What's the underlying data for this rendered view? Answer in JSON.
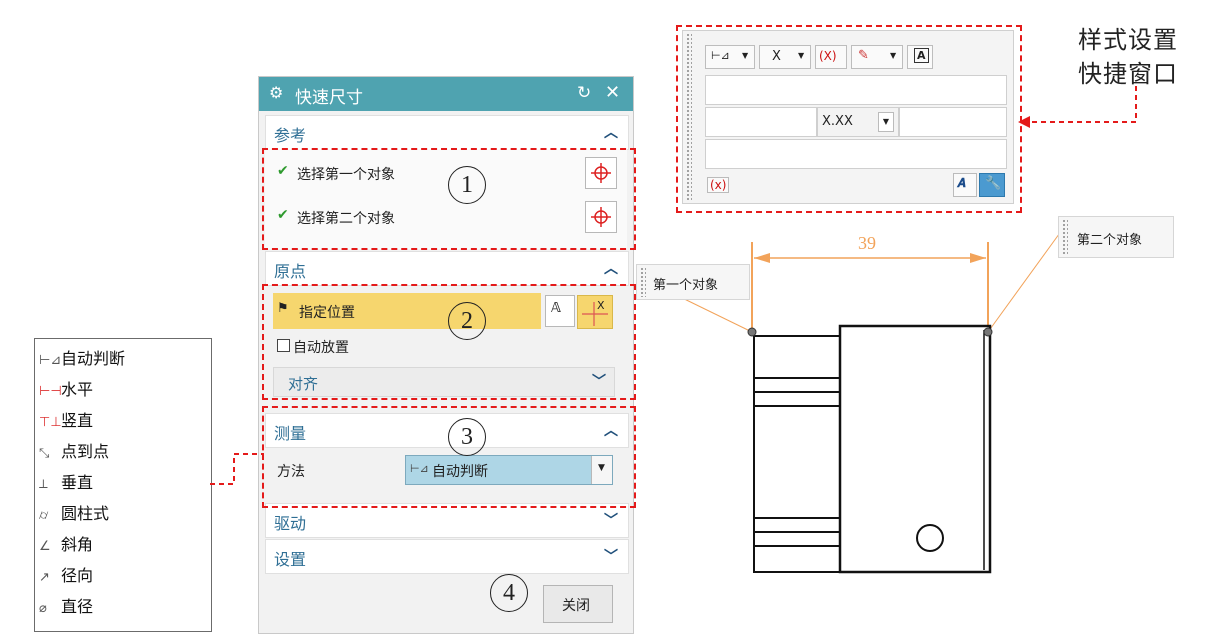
{
  "dialog": {
    "title": "快速尺寸",
    "reference": {
      "title": "参考",
      "first": "选择第一个对象",
      "second": "选择第二个对象"
    },
    "origin": {
      "title": "原点",
      "specify": "指定位置",
      "auto_place": "自动放置",
      "align": "对齐"
    },
    "measure": {
      "title": "测量",
      "method_label": "方法",
      "method_value": "自动判断"
    },
    "drive": {
      "title": "驱动"
    },
    "settings": {
      "title": "设置"
    },
    "close_label": "关闭"
  },
  "callouts": [
    "1",
    "2",
    "3",
    "4"
  ],
  "method_list": [
    "自动判断",
    "水平",
    "竖直",
    "点到点",
    "垂直",
    "圆柱式",
    "斜角",
    "径向",
    "直径"
  ],
  "style_window": {
    "caption_line1": "样式设置",
    "caption_line2": "快捷窗口",
    "precision": "X.XX",
    "tol_x": "X",
    "tol_x2": "(X)",
    "expr": "(x)",
    "text_a": "A"
  },
  "drawing": {
    "dimension_value": "39",
    "first_object": "第一个对象",
    "second_object": "第二个对象"
  },
  "colors": {
    "title_bar": "#4fa3b0",
    "section_text": "#2f6f95",
    "highlight": "#f6d66e",
    "callout_red": "#e41a1a",
    "dimension": "#f2a35a"
  }
}
